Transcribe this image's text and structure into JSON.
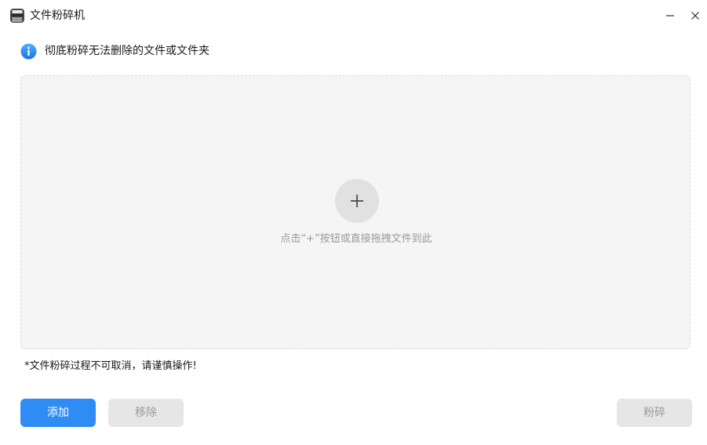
{
  "window": {
    "title": "文件粉碎机",
    "icon": "shredder-icon"
  },
  "info": {
    "icon": "info-icon",
    "text": "彻底粉碎无法删除的文件或文件夹"
  },
  "dropzone": {
    "add_icon": "plus-icon",
    "hint": "点击“+”按钮或直接拖拽文件到此"
  },
  "warning": "*文件粉碎过程不可取消，请谨慎操作!",
  "buttons": {
    "add": "添加",
    "remove": "移除",
    "shred": "粉碎"
  },
  "colors": {
    "accent": "#2f8cf5",
    "disabled_bg": "#e6e6e6",
    "disabled_text": "#9a9a9a",
    "dropzone_bg": "#f5f5f5"
  }
}
